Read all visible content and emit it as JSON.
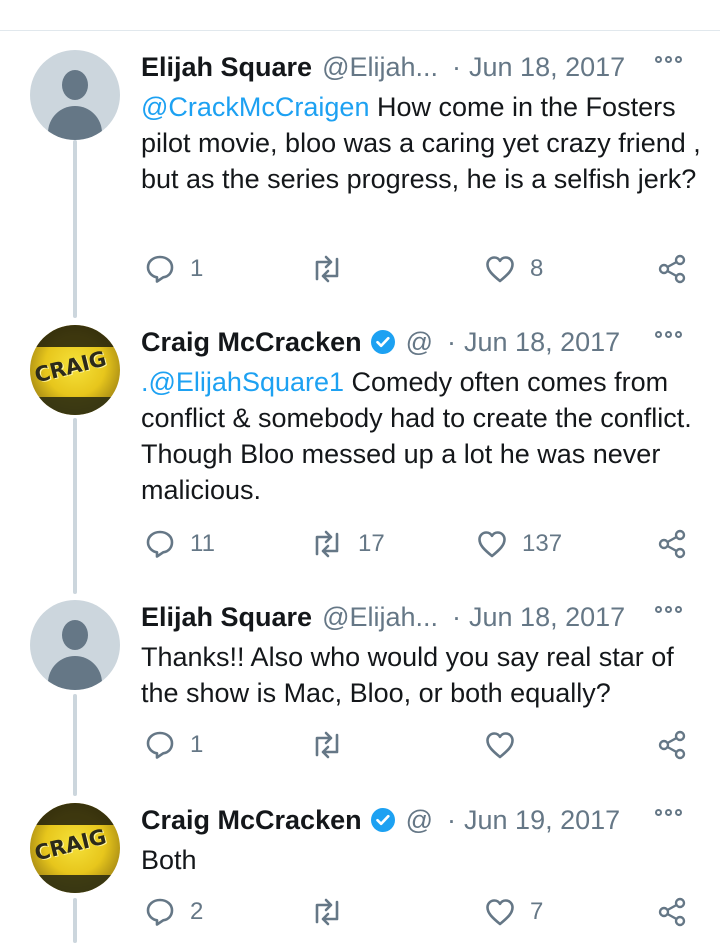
{
  "tweets": [
    {
      "name": "Elijah Square",
      "handle": "@Elijah...",
      "separator": "·",
      "date": "Jun 18, 2017",
      "verified": false,
      "mention": "@CrackMcCraigen",
      "text": " How come in the Fosters pilot movie, bloo was a caring yet crazy friend , but as the series progress, he is a selfish jerk?",
      "replies": "1",
      "retweets": "",
      "likes": "8"
    },
    {
      "name": "Craig McCracken",
      "handle": "@",
      "separator": "·",
      "date": "Jun 18, 2017",
      "verified": true,
      "mention": ".@ElijahSquare1",
      "text": " Comedy often comes from conflict & somebody had to create the conflict. Though Bloo messed up a lot he was never malicious.",
      "replies": "11",
      "retweets": "17",
      "likes": "137"
    },
    {
      "name": "Elijah Square",
      "handle": "@Elijah...",
      "separator": "·",
      "date": "Jun 18, 2017",
      "verified": false,
      "mention": "",
      "text": "Thanks!! Also who would you say real star of the show is Mac, Bloo, or both equally?",
      "replies": "1",
      "retweets": "",
      "likes": ""
    },
    {
      "name": "Craig McCracken",
      "handle": "@",
      "separator": "·",
      "date": "Jun 19, 2017",
      "verified": true,
      "mention": "",
      "text": "Both",
      "replies": "2",
      "retweets": "",
      "likes": "7"
    }
  ],
  "avatar_text": "CRAIG",
  "colors": {
    "accent": "#1da1f2",
    "muted": "#657786",
    "thread_line": "#ccd6dd"
  }
}
